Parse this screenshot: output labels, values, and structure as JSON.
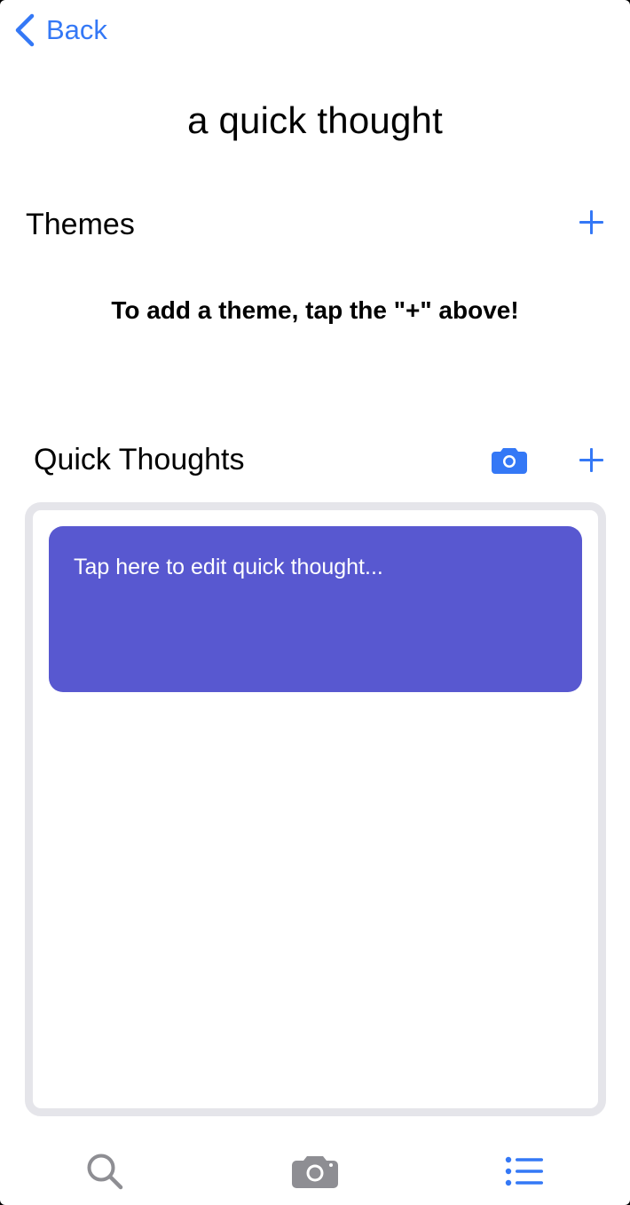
{
  "nav": {
    "back_label": "Back"
  },
  "page": {
    "title": "a quick thought"
  },
  "themes": {
    "label": "Themes",
    "empty_hint": "To add a theme, tap the \"+\" above!"
  },
  "quick_thoughts": {
    "label": "Quick Thoughts",
    "items": [
      {
        "text": "Tap here to edit quick thought...",
        "color": "#5858d0"
      }
    ]
  },
  "tab_bar": {
    "items": [
      {
        "icon": "search-icon",
        "color": "#8e8e93"
      },
      {
        "icon": "camera-icon",
        "color": "#8e8e93"
      },
      {
        "icon": "list-icon",
        "color": "#3478f6",
        "selected": true
      }
    ]
  },
  "colors": {
    "accent": "#3478f6",
    "card": "#5858d0",
    "panel_border": "#e5e5ea",
    "inactive": "#8e8e93"
  }
}
